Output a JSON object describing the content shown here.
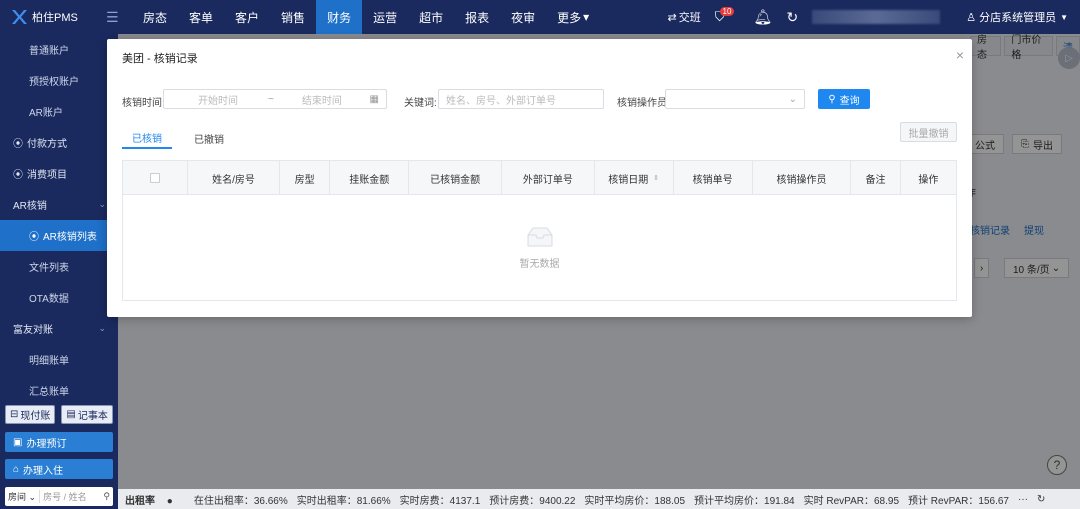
{
  "app": {
    "logo_text": "柏住PMS"
  },
  "topnav": {
    "items": [
      "房态",
      "客单",
      "客户",
      "销售",
      "财务",
      "运营",
      "超市",
      "报表",
      "夜审",
      "更多"
    ],
    "active": "财务",
    "handover_label": "交班",
    "notif_count": "10",
    "user_label": "分店系统管理员"
  },
  "sidebar": {
    "items": [
      {
        "label": "普通账户",
        "type": "sub"
      },
      {
        "label": "预授权账户",
        "type": "sub"
      },
      {
        "label": "AR账户",
        "type": "sub"
      },
      {
        "label": "付款方式",
        "type": "group"
      },
      {
        "label": "消费项目",
        "type": "group"
      },
      {
        "label": "AR核销",
        "type": "group-open"
      },
      {
        "label": "AR核销列表",
        "type": "active"
      },
      {
        "label": "文件列表",
        "type": "sub"
      },
      {
        "label": "OTA数据",
        "type": "sub"
      },
      {
        "label": "富友对账",
        "type": "group-open"
      },
      {
        "label": "明细账单",
        "type": "sub"
      },
      {
        "label": "汇总账单",
        "type": "sub"
      }
    ],
    "btn_cash": "现付账",
    "btn_note": "记事本",
    "btn_booking": "办理预订",
    "btn_checkin": "办理入住",
    "room_select": "房间",
    "room_placeholder": "房号 / 姓名"
  },
  "background": {
    "tab_a": "房态",
    "tab_b": "门市价格",
    "tab_c": "清",
    "btn_formula": "公式",
    "btn_export": "导出",
    "header_cell": "作",
    "link_record": "核销记录",
    "link_withdraw": "提现",
    "page_size": "10 条/页"
  },
  "statusbar": {
    "label": "出租率",
    "items": [
      "在住出租率：36.66%",
      "实时出租率：81.66%",
      "实时房费：4137.1",
      "预计房费：9400.22",
      "实时平均房价：188.05",
      "预计平均房价：191.84",
      "实时 RevPAR：68.95",
      "预计 RevPAR：156.67"
    ]
  },
  "modal": {
    "title": "美团 - 核销记录",
    "filter": {
      "time_label": "核销时间:",
      "start_placeholder": "开始时间",
      "end_placeholder": "结束时间",
      "range_sep": "~",
      "keyword_label": "关键词:",
      "keyword_placeholder": "姓名、房号、外部订单号",
      "operator_label": "核销操作员",
      "search_button": "查询"
    },
    "tabs": [
      "已核销",
      "已撤销"
    ],
    "batch_button": "批量撤销",
    "columns": [
      "姓名/房号",
      "房型",
      "挂账金额",
      "已核销金额",
      "外部订单号",
      "核销日期",
      "核销单号",
      "核销操作员",
      "备注",
      "操作"
    ],
    "empty_text": "暂无数据"
  }
}
